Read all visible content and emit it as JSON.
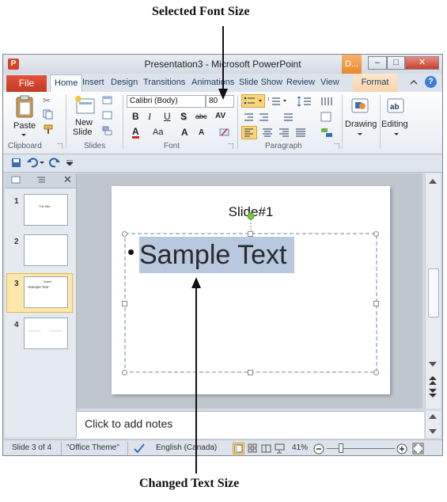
{
  "annotations": {
    "top": "Selected Font Size",
    "bottom": "Changed Text Size"
  },
  "window": {
    "app_icon": "P",
    "title": "Presentation3  -  Microsoft PowerPoint",
    "contextual_group_label": "D...",
    "controls": {
      "minimize": "–",
      "maximize": "□",
      "close": "✕"
    }
  },
  "tabs": {
    "file": "File",
    "items": [
      "Home",
      "Insert",
      "Design",
      "Transitions",
      "Animations",
      "Slide Show",
      "Review",
      "View"
    ],
    "format": "Format",
    "collapse_icon": "caret-up-icon",
    "help": "?"
  },
  "ribbon": {
    "clipboard": {
      "paste": "Paste",
      "group": "Clipboard"
    },
    "slides": {
      "new_slide_line1": "New",
      "new_slide_line2": "Slide",
      "group": "Slides"
    },
    "font": {
      "font_name": "Calibri (Body)",
      "font_size": "80",
      "bold": "B",
      "italic": "I",
      "underline": "U",
      "shadow": "S",
      "strike": "abc",
      "spacing": "AV",
      "font_color": "A",
      "change_case": "Aa",
      "grow": "A",
      "shrink": "A",
      "group": "Font"
    },
    "paragraph": {
      "group": "Paragraph"
    },
    "drawing": {
      "label": "Drawing"
    },
    "editing": {
      "label": "Editing"
    }
  },
  "slides_pane": {
    "thumbnails": [
      {
        "number": "1",
        "text": "Tne titte"
      },
      {
        "number": "2",
        "text": ""
      },
      {
        "number": "3",
        "title": "Insert",
        "text": "•Sample Text"
      },
      {
        "number": "4",
        "text": ""
      }
    ]
  },
  "slide": {
    "title": "Slide#1",
    "bullet": "•",
    "body_text": "Sample Text"
  },
  "notes": {
    "placeholder": "Click to add notes"
  },
  "status": {
    "slide_info": "Slide 3 of 4",
    "theme": "\"Office Theme\"",
    "language": "English (Canada)",
    "zoom": "41%",
    "zoom_level": 0.41
  },
  "colors": {
    "accent_file": "#c23b20",
    "selection": "#b8c8de",
    "contextual": "#f8d3a9"
  }
}
